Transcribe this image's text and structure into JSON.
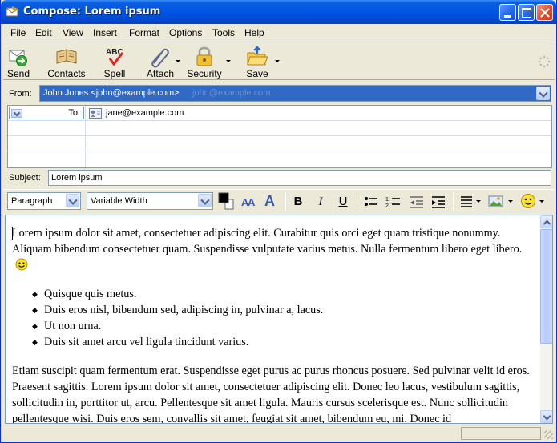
{
  "window": {
    "title": "Compose: Lorem ipsum"
  },
  "menu": [
    "File",
    "Edit",
    "View",
    "Insert",
    "Format",
    "Options",
    "Tools",
    "Help"
  ],
  "toolbar": {
    "send": "Send",
    "contacts": "Contacts",
    "spell": "Spell",
    "attach": "Attach",
    "security": "Security",
    "save": "Save"
  },
  "header": {
    "from_label": "From:",
    "from_value": "John Jones <john@example.com>",
    "from_ghost": "john@example.com",
    "to_label": "To:",
    "to_value": "jane@example.com",
    "subject_label": "Subject:",
    "subject_value": "Lorem ipsum"
  },
  "format": {
    "paragraph": "Paragraph",
    "font": "Variable Width",
    "bold": "B",
    "italic": "I",
    "underline": "U"
  },
  "body": {
    "p1": "Lorem ipsum dolor sit amet, consectetuer adipiscing elit. Curabitur quis orci eget quam tristique nonummy. Aliquam bibendum consectetuer quam. Suspendisse vulputate varius metus. Nulla fermentum libero eget libero.",
    "items": [
      "Quisque quis metus.",
      "Duis eros nisl, bibendum sed, adipiscing in, pulvinar a, lacus.",
      "Ut non urna.",
      "Duis sit amet arcu vel ligula tincidunt varius."
    ],
    "p2": "Etiam suscipit quam fermentum erat. Suspendisse eget purus ac purus rhoncus posuere. Sed pulvinar velit id eros. Praesent sagittis. Lorem ipsum dolor sit amet, consectetuer adipiscing elit. Donec leo lacus, vestibulum sagittis, sollicitudin in, porttitor ut, arcu. Pellentesque sit amet ligula. Mauris cursus scelerisque est. Nunc sollicitudin pellentesque wisi. Duis eros sem, convallis sit amet, feugiat sit amet, bibendum eu, mi. Donec id"
  },
  "colors": {
    "titlebar": "#0055e5",
    "selection": "#316ac5",
    "chrome": "#ece9d8"
  }
}
